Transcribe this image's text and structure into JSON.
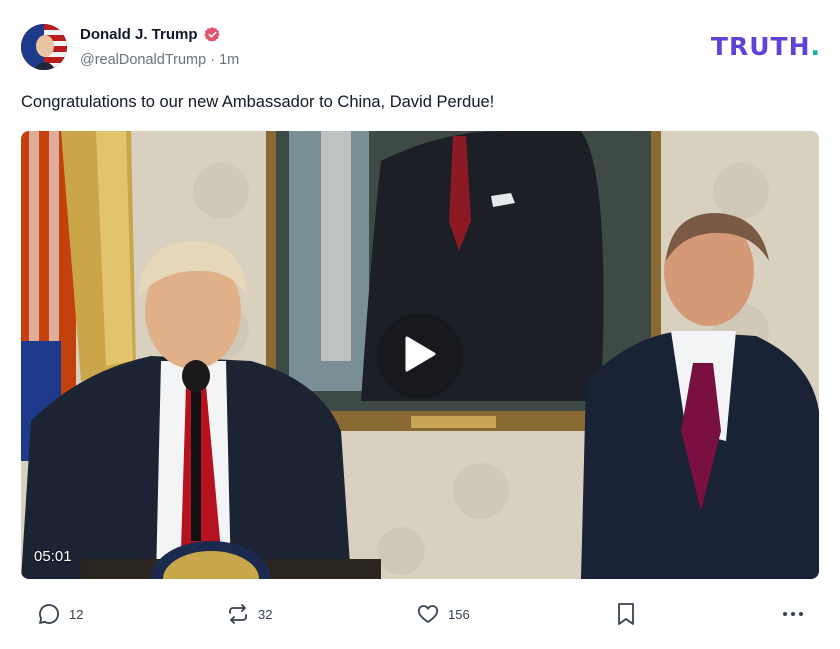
{
  "post": {
    "author": {
      "display_name": "Donald J. Trump",
      "handle": "@realDonaldTrump",
      "separator": " · ",
      "time_ago": "1m",
      "verified_icon": "verified-badge-icon"
    },
    "brand": {
      "logo_text": "TRUTH",
      "logo_dot": "."
    },
    "text": "Congratulations to our new Ambassador to China, David Perdue!",
    "media": {
      "type": "video",
      "duration": "05:01",
      "play_icon": "play-icon"
    },
    "actions": {
      "replies": "12",
      "retruths": "32",
      "likes": "156",
      "reply_icon": "comment-icon",
      "retruth_icon": "repost-icon",
      "like_icon": "heart-icon",
      "bookmark_icon": "bookmark-icon",
      "more_icon": "more-horizontal-icon"
    }
  },
  "colors": {
    "brand_purple": "#5c45d6",
    "brand_teal": "#10b3a0",
    "verified": "#e0556e",
    "text_primary": "#111827",
    "text_secondary": "#6b7280"
  }
}
